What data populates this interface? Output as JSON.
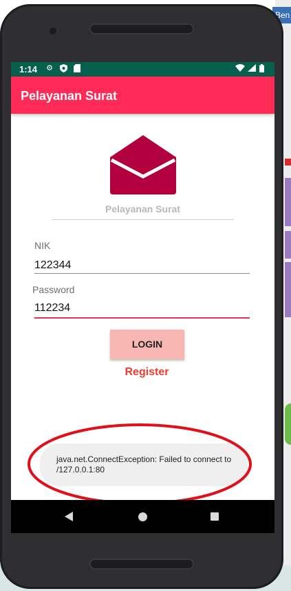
{
  "status_bar": {
    "time": "1:14"
  },
  "app_bar": {
    "title": "Pelayanan Surat"
  },
  "logo": {
    "app_name": "Pelayanan Surat"
  },
  "form": {
    "nik_label": "NIK",
    "nik_value": "122344",
    "password_label": "Password",
    "password_value": "112234",
    "login_label": "LOGIN",
    "register_label": "Register"
  },
  "toast": {
    "message": "java.net.ConnectException: Failed to connect to /127.0.0.1:80"
  },
  "background": {
    "window_title_fragment": "Ben"
  },
  "colors": {
    "status_bar": "#05604e",
    "app_bar": "#ff2a55",
    "envelope": "#b2003f",
    "login_button": "#f7b6b1",
    "register_text": "#f23b2e",
    "focused_underline": "#e8305c",
    "annotation_circle": "#e0101a"
  }
}
